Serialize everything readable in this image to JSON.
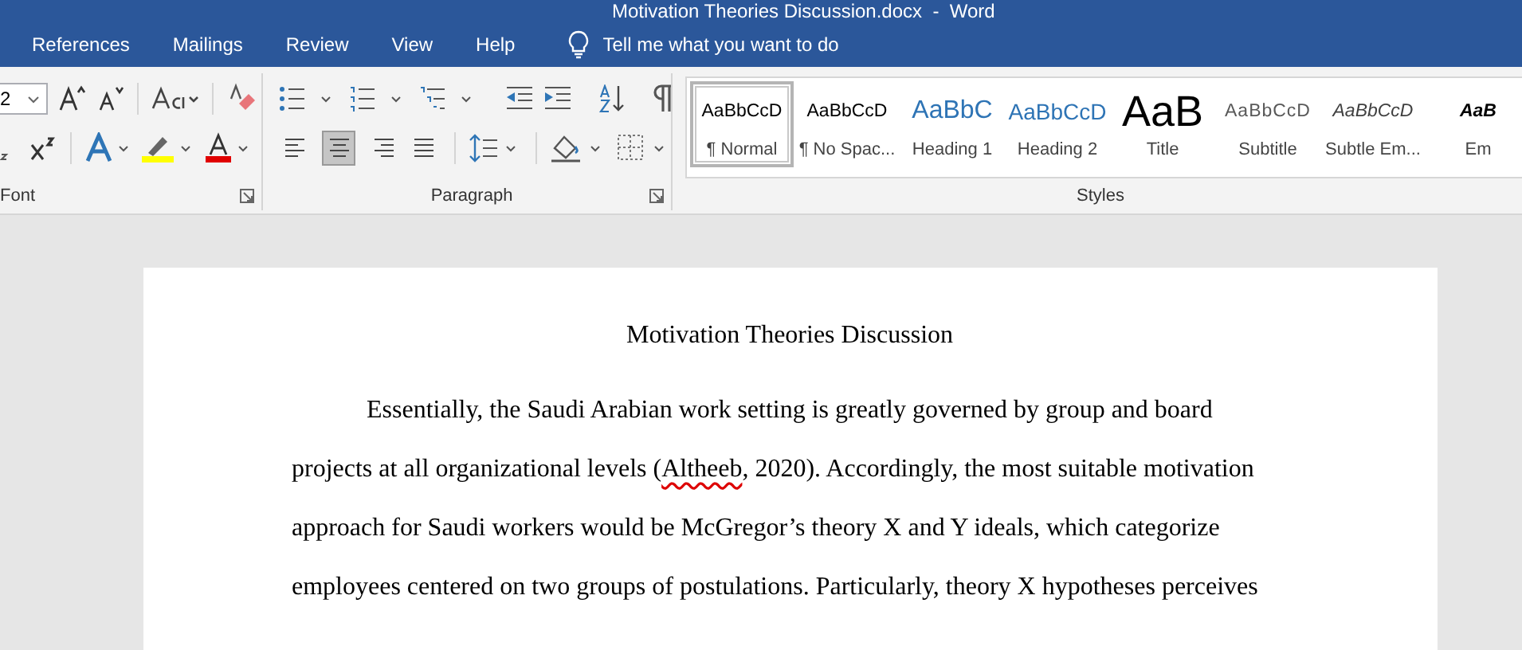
{
  "window": {
    "title": "Motivation Theories Discussion.docx  -  Word"
  },
  "tabs": [
    {
      "label": "References",
      "selected": false
    },
    {
      "label": "Mailings",
      "selected": false
    },
    {
      "label": "Review",
      "selected": false
    },
    {
      "label": "View",
      "selected": false
    },
    {
      "label": "Help",
      "selected": false
    }
  ],
  "tell_me": {
    "placeholder": "Tell me what you want to do"
  },
  "ribbon": {
    "font_group": {
      "label": "Font",
      "font_size": "2"
    },
    "paragraph_group": {
      "label": "Paragraph",
      "alignment_buttons": [
        {
          "kind": "left",
          "selected": false
        },
        {
          "kind": "center",
          "selected": true
        },
        {
          "kind": "right",
          "selected": false
        },
        {
          "kind": "justify",
          "selected": false
        }
      ]
    },
    "styles_group": {
      "label": "Styles",
      "styles": [
        {
          "kind": "normal",
          "preview": "AaBbCcD",
          "label": "¶ Normal",
          "selected": true
        },
        {
          "kind": "normal",
          "preview": "AaBbCcD",
          "label": "¶ No Spac...",
          "selected": false
        },
        {
          "kind": "heading1",
          "preview": "AaBbC",
          "label": "Heading 1",
          "selected": false
        },
        {
          "kind": "heading2",
          "preview": "AaBbCcD",
          "label": "Heading 2",
          "selected": false
        },
        {
          "kind": "title",
          "preview": "AaB",
          "label": "Title",
          "selected": false
        },
        {
          "kind": "subtitle",
          "preview": "AaBbCcD",
          "label": "Subtitle",
          "selected": false
        },
        {
          "kind": "subtle",
          "preview": "AaBbCcD",
          "label": "Subtle Em...",
          "selected": false
        },
        {
          "kind": "emphasis",
          "preview": "AaB",
          "label": "Em",
          "selected": false
        }
      ]
    }
  },
  "document": {
    "title": "Motivation Theories Discussion",
    "lines": [
      [
        {
          "text": "Essentially, the Saudi Arabian work setting is greatly governed by group and board",
          "misspelled": false
        }
      ],
      [
        {
          "text": "projects at all organizational levels (",
          "misspelled": false
        },
        {
          "text": "Altheeb",
          "misspelled": true
        },
        {
          "text": ", 2020). Accordingly, the most suitable motivation",
          "misspelled": false
        }
      ],
      [
        {
          "text": "approach for Saudi workers would be McGregor’s theory X and Y ideals, which categorize",
          "misspelled": false
        }
      ],
      [
        {
          "text": "employees centered on two groups of postulations. Particularly, theory X hypotheses perceives",
          "misspelled": false
        }
      ]
    ]
  }
}
